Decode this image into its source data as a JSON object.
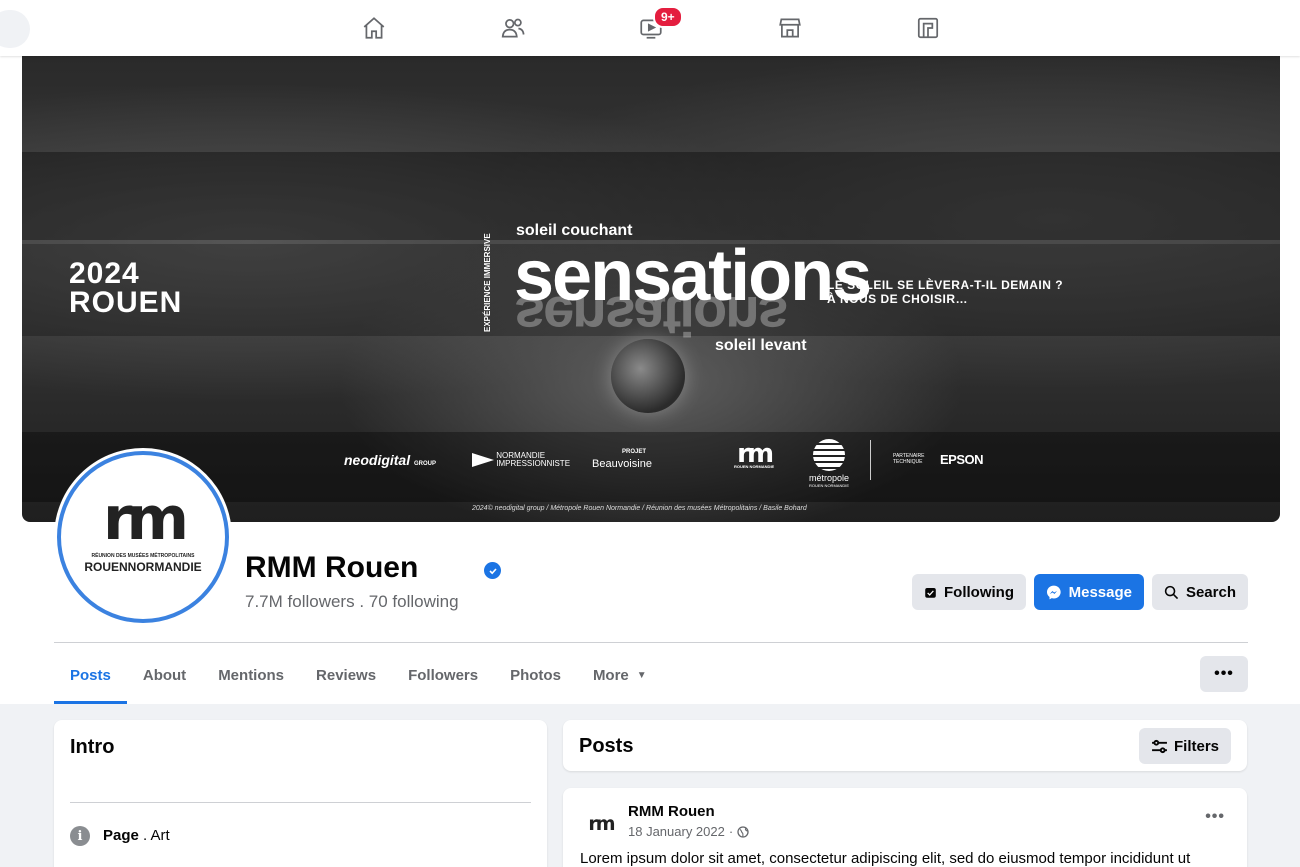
{
  "nav": {
    "notification_badge": "9+",
    "icons": [
      "home-icon",
      "friends-icon",
      "video-icon",
      "marketplace-icon",
      "gaming-icon"
    ]
  },
  "cover": {
    "year": "2024",
    "city": "ROUEN",
    "soleil_couchant": "soleil couchant",
    "main_word": "sensations",
    "soleil_levant": "soleil levant",
    "vertical_text": "EXPÉRIENCE IMMERSIVE",
    "tagline_line1": "LE SOLEIL SE LÈVERA-T-IL DEMAIN ?",
    "tagline_line2": "À NOUS DE CHOISIR…",
    "logos": {
      "neodigital": "neodigital",
      "neodigital_sub": "GROUP",
      "normandie_line1": "NORMANDIE",
      "normandie_line2": "IMPRESSIONNISTE",
      "projet": "PROJET",
      "beauvoisine": "Beauvoisine",
      "rm": "rm",
      "rm_sub": "ROUEN NORMANDIE",
      "metropole": "métropole",
      "metropole_sub": "ROUEN NORMANDIE",
      "partenaire_line1": "PARTENAIRE",
      "partenaire_line2": "TECHNIQUE",
      "epson": "EPSON"
    },
    "credit": "2024© neodigital group / Métropole Rouen Normandie / Réunion des musées Métropolitains / Basile Bohard"
  },
  "profile": {
    "avatar_logo": "rm",
    "avatar_subtitle": "RÉUNION DES MUSÉES MÉTROPOLITAINS",
    "avatar_name": "ROUENNORMANDIE",
    "name": "RMM Rouen",
    "followers": "7.7M followers . 70 following",
    "buttons": {
      "following": "Following",
      "message": "Message",
      "search": "Search"
    }
  },
  "tabs": {
    "posts": "Posts",
    "about": "About",
    "mentions": "Mentions",
    "reviews": "Reviews",
    "followers": "Followers",
    "photos": "Photos",
    "more": "More",
    "more_dots": "•••"
  },
  "intro": {
    "title": "Intro",
    "category_label": "Page",
    "category_value": " . Art"
  },
  "posts": {
    "title": "Posts",
    "filters": "Filters",
    "post": {
      "avatar_logo": "rm",
      "author": "RMM Rouen",
      "date": "18 January 2022",
      "separator": "·",
      "text": "Lorem ipsum dolor sit amet, consectetur adipiscing elit, sed do eiusmod tempor incididunt ut",
      "dots": "•••"
    }
  },
  "colors": {
    "accent": "#1b74e4",
    "badge": "#e41e3f",
    "background": "#f0f2f5"
  }
}
